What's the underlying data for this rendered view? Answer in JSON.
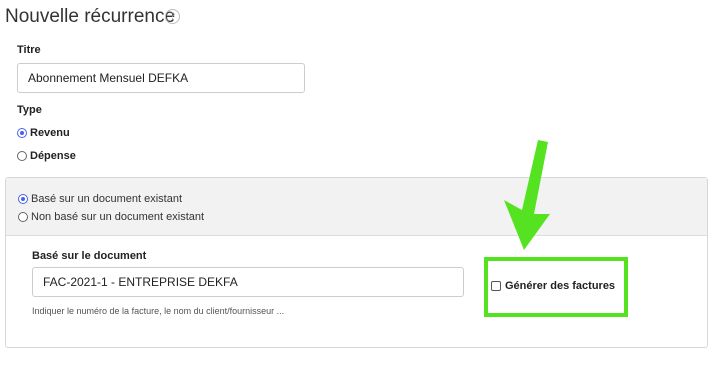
{
  "page": {
    "title": "Nouvelle récurrence",
    "help_icon": "?"
  },
  "form": {
    "titre_label": "Titre",
    "titre_value": "Abonnement Mensuel DEFKA",
    "type_label": "Type",
    "type_options": [
      {
        "label": "Revenu",
        "selected": true
      },
      {
        "label": "Dépense",
        "selected": false
      }
    ]
  },
  "document_panel": {
    "source_options": [
      {
        "label": "Basé sur un document existant",
        "selected": true
      },
      {
        "label": "Non basé sur un document existant",
        "selected": false
      }
    ],
    "doc_label": "Basé sur le document",
    "doc_value": "FAC-2021-1 - ENTREPRISE DEKFA",
    "doc_hint": "Indiquer le numéro de la facture, le nom du client/fournisseur ...",
    "generate_invoices_label": "Générer des factures",
    "generate_invoices_checked": false
  },
  "annotation": {
    "highlight_color": "#55e321",
    "arrow_icon": "arrow-down-icon"
  }
}
